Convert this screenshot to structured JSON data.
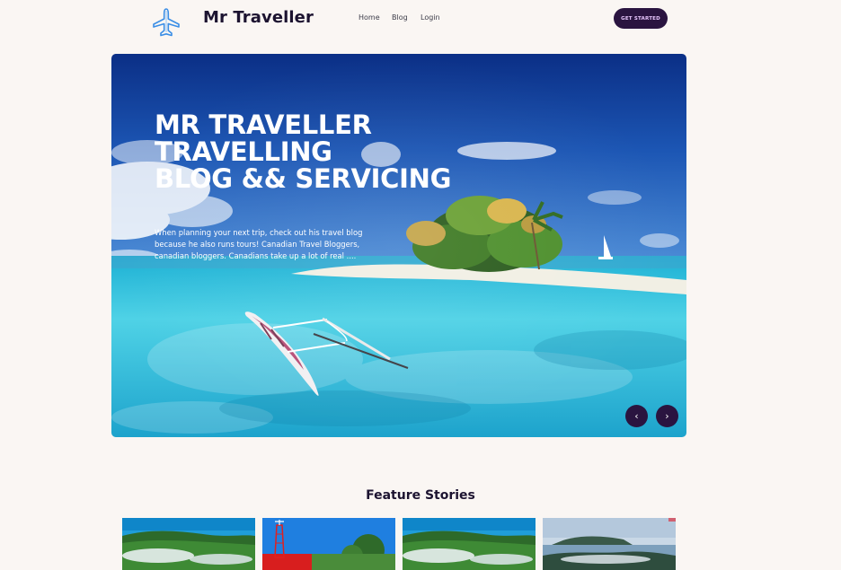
{
  "nav": {
    "brand": "Mr Traveller",
    "links": [
      "Home",
      "Blog",
      "Login"
    ],
    "cta_label": "GET STARTED",
    "logo_icon": "airplane-icon"
  },
  "hero": {
    "title_lines": [
      "MR TRAVELLER",
      "TRAVELLING",
      "BLOG && SERVICING"
    ],
    "description": "When planning your next trip, check out his travel blog because he also runs tours! Canadian Travel Bloggers, canadian bloggers. Canadians take up a lot of real ....",
    "prev_icon": "chevron-left-icon",
    "next_icon": "chevron-right-icon",
    "prev_glyph": "‹",
    "next_glyph": "›"
  },
  "feature": {
    "title": "Feature Stories",
    "cards": [
      "island-forest-photo",
      "lighthouse-photo",
      "island-forest-photo",
      "misty-island-photo"
    ]
  },
  "colors": {
    "background": "#faf6f3",
    "accent": "#2a1440",
    "cta_text": "#e9c7ff"
  }
}
